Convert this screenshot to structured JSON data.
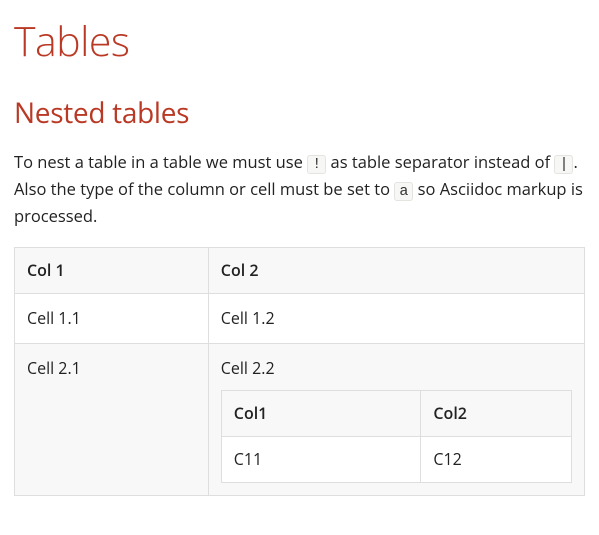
{
  "title": "Tables",
  "subtitle": "Nested tables",
  "intro": {
    "p1a": "To nest a table in a table we must use ",
    "code1": "!",
    "p1b": " as table separator instead of ",
    "code2": "|",
    "p1c": ". Also the type of the column or cell must be set to ",
    "code3": "a",
    "p1d": " so Asciidoc markup is processed."
  },
  "table": {
    "headers": [
      "Col 1",
      "Col 2"
    ],
    "rows": [
      {
        "c1": "Cell 1.1",
        "c2": "Cell 1.2"
      },
      {
        "c1": "Cell 2.1",
        "c2label": "Cell 2.2",
        "nested": {
          "headers": [
            "Col1",
            "Col2"
          ],
          "rows": [
            {
              "c1": "C11",
              "c2": "C12"
            }
          ]
        }
      }
    ]
  }
}
